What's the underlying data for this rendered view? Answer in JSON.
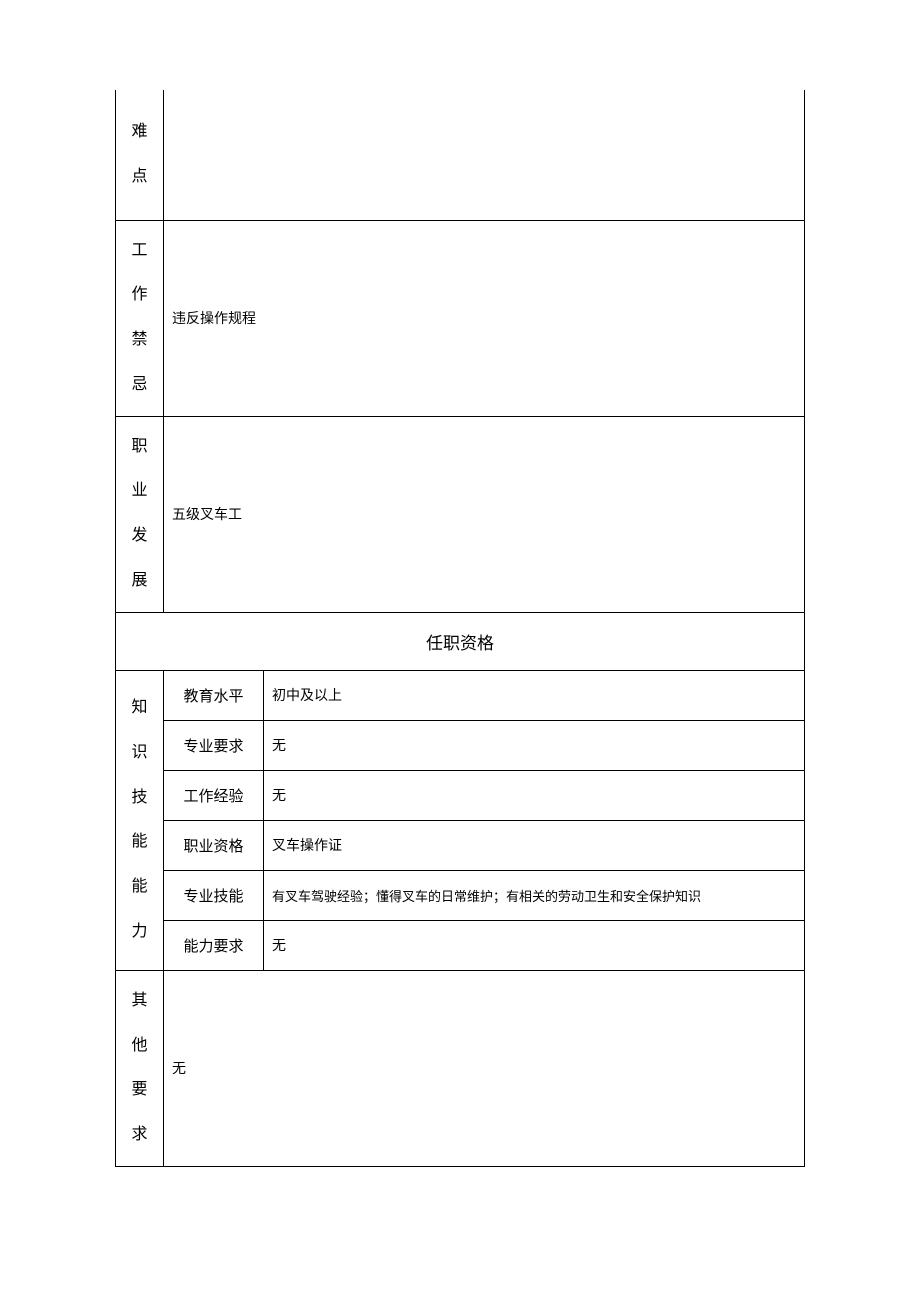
{
  "rows": {
    "difficulty": {
      "label_chars": [
        "难",
        "点"
      ],
      "value": ""
    },
    "taboo": {
      "label_chars": [
        "工",
        "作",
        "禁",
        "忌"
      ],
      "value": "违反操作规程"
    },
    "career": {
      "label_chars": [
        "职",
        "业",
        "发",
        "展"
      ],
      "value": "五级叉车工"
    }
  },
  "section_header": "任职资格",
  "qualifications": {
    "group_label_chars": [
      "知",
      "识",
      "技",
      "能",
      "能",
      "力"
    ],
    "items": [
      {
        "label": "教育水平",
        "value": "初中及以上"
      },
      {
        "label": "专业要求",
        "value": "无"
      },
      {
        "label": "工作经验",
        "value": "无"
      },
      {
        "label": "职业资格",
        "value": "叉车操作证"
      },
      {
        "label": "专业技能",
        "value": "有叉车驾驶经验；懂得叉车的日常维护；有相关的劳动卫生和安全保护知识"
      },
      {
        "label": "能力要求",
        "value": "无"
      }
    ]
  },
  "other": {
    "label_chars": [
      "其",
      "他",
      "要",
      "求"
    ],
    "value": "无"
  }
}
